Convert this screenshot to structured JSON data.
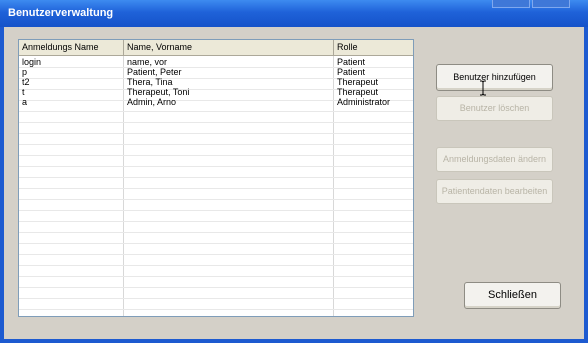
{
  "window": {
    "title": "Benutzerverwaltung"
  },
  "table": {
    "columns": [
      "Anmeldungs Name",
      "Name, Vorname",
      "Rolle"
    ],
    "rows": [
      [
        "login",
        "name, vor",
        "Patient"
      ],
      [
        "p",
        "Patient, Peter",
        "Patient"
      ],
      [
        "t2",
        "Thera, Tina",
        "Therapeut"
      ],
      [
        "t",
        "Therapeut, Toni",
        "Therapeut"
      ],
      [
        "a",
        "Admin, Arno",
        "Administrator"
      ]
    ]
  },
  "buttons": {
    "add_user": "Benutzer hinzufügen",
    "delete_user": "Benutzer löschen",
    "change_login": "Anmeldungsdaten ändern",
    "edit_patient": "Patientendaten bearbeiten",
    "close": "Schließen"
  },
  "colors": {
    "titlebar": "#1f62d9",
    "dialog_bg": "#d4d0c8"
  }
}
